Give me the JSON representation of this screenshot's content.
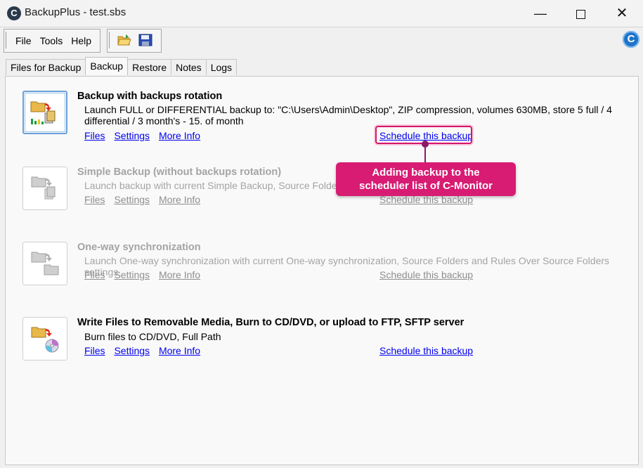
{
  "window": {
    "title": "BackupPlus - test.sbs",
    "app_icon_letter": "C",
    "minimize": "—",
    "close": "✕"
  },
  "menu": {
    "file": "File",
    "tools": "Tools",
    "help": "Help"
  },
  "toolbar": {
    "open_icon": "folder-open-icon",
    "save_icon": "floppy-save-icon",
    "brand_letter": "C"
  },
  "tabs": [
    {
      "label": "Files for Backup"
    },
    {
      "label": "Backup",
      "active": true
    },
    {
      "label": "Restore"
    },
    {
      "label": "Notes"
    },
    {
      "label": "Logs"
    }
  ],
  "sections": [
    {
      "title": "Backup with backups rotation",
      "description": "Launch FULL or DIFFERENTIAL backup to: \"C:\\Users\\Admin\\Desktop\", ZIP compression, volumes 630MB, store 5 full / 4 differential / 3 month's - 15. of month",
      "links": [
        "Files",
        "Settings",
        "More Info"
      ],
      "schedule": "Schedule this backup",
      "enabled": true
    },
    {
      "title": "Simple Backup (without backups rotation)",
      "description": "Launch backup with current Simple Backup, Source Folders",
      "links": [
        "Files",
        "Settings",
        "More Info"
      ],
      "schedule": "Schedule this backup",
      "enabled": false
    },
    {
      "title": "One-way synchronization",
      "description": "Launch One-way synchronization with current One-way synchronization, Source Folders and Rules Over Source Folders settings",
      "links": [
        "Files",
        "Settings",
        "More Info"
      ],
      "schedule": "Schedule this backup",
      "enabled": false
    },
    {
      "title": "Write Files to Removable Media, Burn to CD/DVD, or upload to FTP, SFTP server",
      "description": "Burn files to CD/DVD, Full Path",
      "links": [
        "Files",
        "Settings",
        "More Info"
      ],
      "schedule": "Schedule this backup",
      "enabled": true
    }
  ],
  "callout": {
    "line1": "Adding backup to the",
    "line2": "scheduler list of C-Monitor",
    "color": "#d81b73"
  }
}
